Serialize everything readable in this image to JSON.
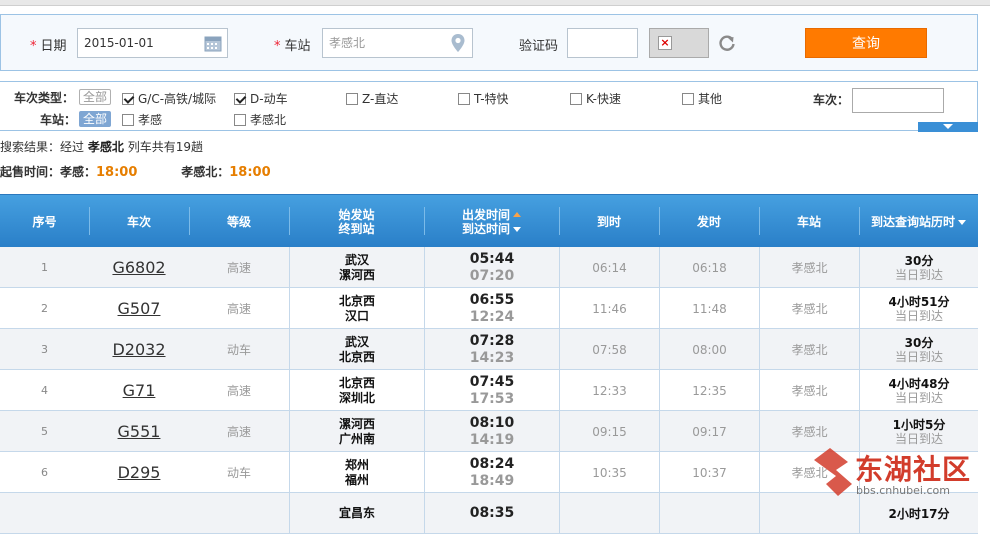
{
  "search": {
    "date_label": "日期",
    "date_value": "2015-01-01",
    "station_label": "车站",
    "station_value": "孝感北",
    "captcha_label": "验证码",
    "captcha_value": "",
    "query_button": "查询"
  },
  "filters": {
    "type_label": "车次类型：",
    "all_label": "全部",
    "types": [
      {
        "label": "G/C-高铁/城际",
        "checked": true
      },
      {
        "label": "D-动车",
        "checked": true
      },
      {
        "label": "Z-直达",
        "checked": false
      },
      {
        "label": "T-特快",
        "checked": false
      },
      {
        "label": "K-快速",
        "checked": false
      },
      {
        "label": "其他",
        "checked": false
      }
    ],
    "station_label": "车站：",
    "station_all": "全部",
    "stations": [
      {
        "label": "孝感",
        "checked": false
      },
      {
        "label": "孝感北",
        "checked": false
      }
    ],
    "train_no_label": "车次：",
    "train_no_value": ""
  },
  "info": {
    "result_prefix": "搜索结果：经过",
    "result_station": "孝感北",
    "result_suffix": "列车共有19趟",
    "sale_prefix": "起售时间：孝感：",
    "sale_time_1": "18:00",
    "sale_mid": "孝感北：",
    "sale_time_2": "18:00"
  },
  "table": {
    "headers": {
      "seq": "序号",
      "train": "车次",
      "grade": "等级",
      "from": "始发站",
      "to": "终到站",
      "dep": "出发时间",
      "arr": "到达时间",
      "arrive": "到时",
      "depart": "发时",
      "station": "车站",
      "duration": "到达查询站历时"
    },
    "rows": [
      {
        "seq": "1",
        "train": "G6802",
        "grade": "高速",
        "from": "武汉",
        "to": "漯河西",
        "dep": "05:44",
        "arr": "07:20",
        "arrive": "06:14",
        "depart": "06:18",
        "station": "孝感北",
        "duration": "30分",
        "status": "当日到达"
      },
      {
        "seq": "2",
        "train": "G507",
        "grade": "高速",
        "from": "北京西",
        "to": "汉口",
        "dep": "06:55",
        "arr": "12:24",
        "arrive": "11:46",
        "depart": "11:48",
        "station": "孝感北",
        "duration": "4小时51分",
        "status": "当日到达"
      },
      {
        "seq": "3",
        "train": "D2032",
        "grade": "动车",
        "from": "武汉",
        "to": "北京西",
        "dep": "07:28",
        "arr": "14:23",
        "arrive": "07:58",
        "depart": "08:00",
        "station": "孝感北",
        "duration": "30分",
        "status": "当日到达"
      },
      {
        "seq": "4",
        "train": "G71",
        "grade": "高速",
        "from": "北京西",
        "to": "深圳北",
        "dep": "07:45",
        "arr": "17:53",
        "arrive": "12:33",
        "depart": "12:35",
        "station": "孝感北",
        "duration": "4小时48分",
        "status": "当日到达"
      },
      {
        "seq": "5",
        "train": "G551",
        "grade": "高速",
        "from": "漯河西",
        "to": "广州南",
        "dep": "08:10",
        "arr": "14:19",
        "arrive": "09:15",
        "depart": "09:17",
        "station": "孝感北",
        "duration": "1小时5分",
        "status": "当日到达"
      },
      {
        "seq": "6",
        "train": "D295",
        "grade": "动车",
        "from": "郑州",
        "to": "福州",
        "dep": "08:24",
        "arr": "18:49",
        "arrive": "10:35",
        "depart": "10:37",
        "station": "孝感北",
        "duration": "",
        "status": ""
      },
      {
        "seq": "",
        "train": "",
        "grade": "",
        "from": "宜昌东",
        "to": "",
        "dep": "08:35",
        "arr": "",
        "arrive": "",
        "depart": "",
        "station": "",
        "duration": "2小时17分",
        "status": ""
      }
    ]
  },
  "watermark": {
    "brand": "东湖社区",
    "url": "bbs.cnhubei.com",
    "color": "#d23c2b"
  },
  "colors": {
    "accent_orange": "#ff7a00",
    "header_blue": "#2a7fc8",
    "time_orange": "#e67e00"
  }
}
